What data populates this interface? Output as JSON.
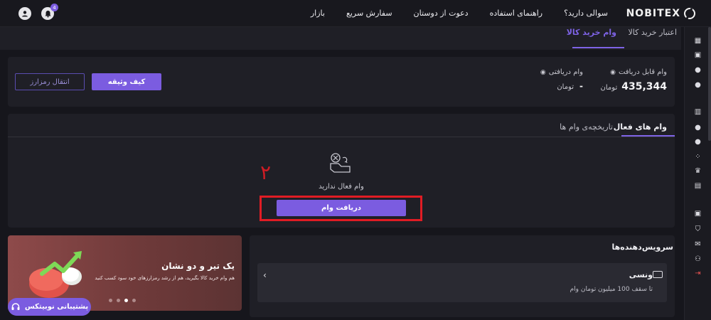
{
  "header": {
    "brand": "NOBITEX",
    "nav": [
      "بازار",
      "سفارش سریع",
      "دعوت از دوستان",
      "راهنمای استفاده",
      "سوالی دارید؟"
    ],
    "notification_count": "4"
  },
  "page_tabs": {
    "active": "وام خرید کالا",
    "inactive": "اعتبار خرید کالا"
  },
  "loan_info": {
    "eligible_label": "وام قابل دریافت",
    "eligible_value": "435,344",
    "eligible_unit": "تومان",
    "received_label": "وام دریافتی",
    "received_value": "-",
    "received_unit": "تومان",
    "collateral_button": "کیف وثیقه",
    "transfer_button": "انتقال رمزارز"
  },
  "loans": {
    "tab_active": "وام های فعال",
    "tab_history": "تاریخچه‌ی وام ها",
    "empty_message": "وام فعال ندارید",
    "get_loan_button": "دریافت وام",
    "annotation_number": "۲"
  },
  "services": {
    "title": "سرویس‌دهنده‌ها",
    "provider_name": "ونسی",
    "provider_desc": "تا سقف 100 میلیون تومان وام"
  },
  "banner": {
    "title": "یک تیر و دو نشان",
    "subtitle": "هم وام خرید کالا بگیرید، هم از رشد رمزارزهای خود سود کسب کنید"
  },
  "support": {
    "label": "پشتیبانی نوبیتکس"
  },
  "colors": {
    "accent": "#7b5ce0",
    "background": "#16161c",
    "panel": "#1f1f26",
    "annotation_red": "#e01c24"
  }
}
